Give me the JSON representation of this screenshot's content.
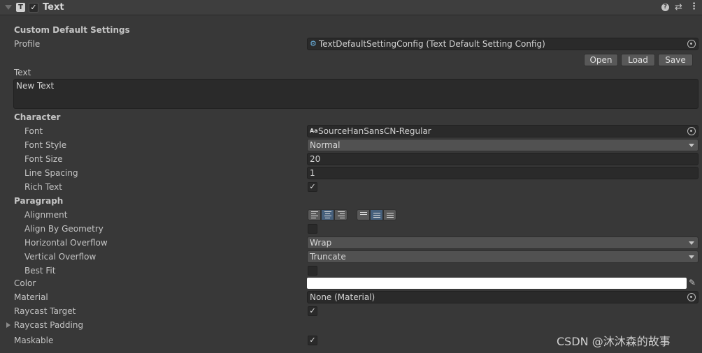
{
  "header": {
    "title": "Text",
    "enabled": true,
    "icons": [
      "foldout-arrow-icon",
      "text-component-icon",
      "help-icon",
      "presets-icon",
      "more-menu-icon"
    ]
  },
  "custom": {
    "section": "Custom Default Settings",
    "profile_label": "Profile",
    "profile_value": "TextDefaultSettingConfig (Text Default Setting Config)",
    "open": "Open",
    "load": "Load",
    "save": "Save"
  },
  "text": {
    "label": "Text",
    "value": "New Text"
  },
  "character": {
    "section": "Character",
    "font_label": "Font",
    "font_value": "SourceHanSansCN-Regular",
    "font_icon": "Aa",
    "style_label": "Font Style",
    "style_value": "Normal",
    "size_label": "Font Size",
    "size_value": "20",
    "spacing_label": "Line Spacing",
    "spacing_value": "1",
    "rich_label": "Rich Text",
    "rich_checked": true
  },
  "paragraph": {
    "section": "Paragraph",
    "alignment_label": "Alignment",
    "horizontal_alignment": "center",
    "vertical_alignment": "middle",
    "geometry_label": "Align By Geometry",
    "geometry_checked": false,
    "hover_label": "Horizontal Overflow",
    "hover_value": "Wrap",
    "vover_label": "Vertical Overflow",
    "vover_value": "Truncate",
    "bestfit_label": "Best Fit",
    "bestfit_checked": false
  },
  "color": {
    "label": "Color",
    "value": "#ffffff"
  },
  "material": {
    "label": "Material",
    "value": "None (Material)"
  },
  "raycast": {
    "label": "Raycast Target",
    "checked": true,
    "padding_label": "Raycast Padding"
  },
  "maskable": {
    "label": "Maskable",
    "checked": true
  },
  "watermark": "CSDN @沐沐森的故事",
  "check_glyph": "✓"
}
